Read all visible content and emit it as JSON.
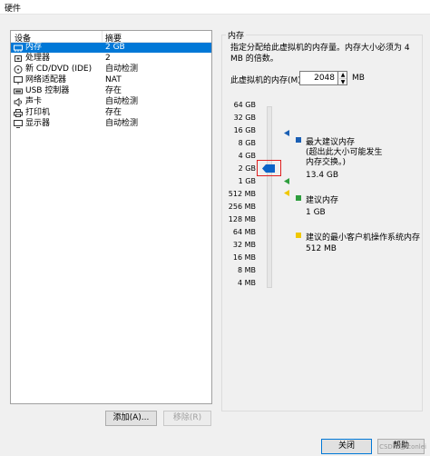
{
  "window": {
    "title": "硬件"
  },
  "device_list": {
    "columns": [
      "设备",
      "摘要"
    ],
    "items": [
      {
        "name": "内存",
        "summary": "2 GB",
        "icon": "memory-icon",
        "selected": true
      },
      {
        "name": "处理器",
        "summary": "2",
        "icon": "cpu-icon"
      },
      {
        "name": "新 CD/DVD (IDE)",
        "summary": "自动检测",
        "icon": "cd-dvd-icon"
      },
      {
        "name": "网络适配器",
        "summary": "NAT",
        "icon": "network-icon"
      },
      {
        "name": "USB 控制器",
        "summary": "存在",
        "icon": "usb-icon"
      },
      {
        "name": "声卡",
        "summary": "自动检测",
        "icon": "sound-icon"
      },
      {
        "name": "打印机",
        "summary": "存在",
        "icon": "printer-icon"
      },
      {
        "name": "显示器",
        "summary": "自动检测",
        "icon": "display-icon"
      }
    ],
    "add_button": "添加(A)...",
    "remove_button": "移除(R)"
  },
  "memory": {
    "group_title": "内存",
    "description": "指定分配给此虚拟机的内存量。内存大小必须为 4 MB 的倍数。",
    "field_label": "此虚拟机的内存(M):",
    "value": "2048",
    "unit": "MB",
    "scale_labels": [
      "64 GB",
      "32 GB",
      "16 GB",
      "8 GB",
      "4 GB",
      "2 GB",
      "1 GB",
      "512 MB",
      "256 MB",
      "128 MB",
      "64 MB",
      "32 MB",
      "16 MB",
      "8 MB",
      "4 MB"
    ],
    "legend": {
      "max": {
        "title": "最大建议内存",
        "note": "(超出此大小可能发生内存交换。)",
        "value": "13.4 GB",
        "color": "#1a5fb4"
      },
      "recommended": {
        "title": "建议内存",
        "value": "1 GB",
        "color": "#2e9e3e"
      },
      "min": {
        "title": "建议的最小客户机操作系统内存",
        "value": "512 MB",
        "color": "#f0c800"
      }
    }
  },
  "footer": {
    "close_button": "关闭",
    "help_button": "帮助"
  },
  "watermark": "CSDN @iconlei"
}
